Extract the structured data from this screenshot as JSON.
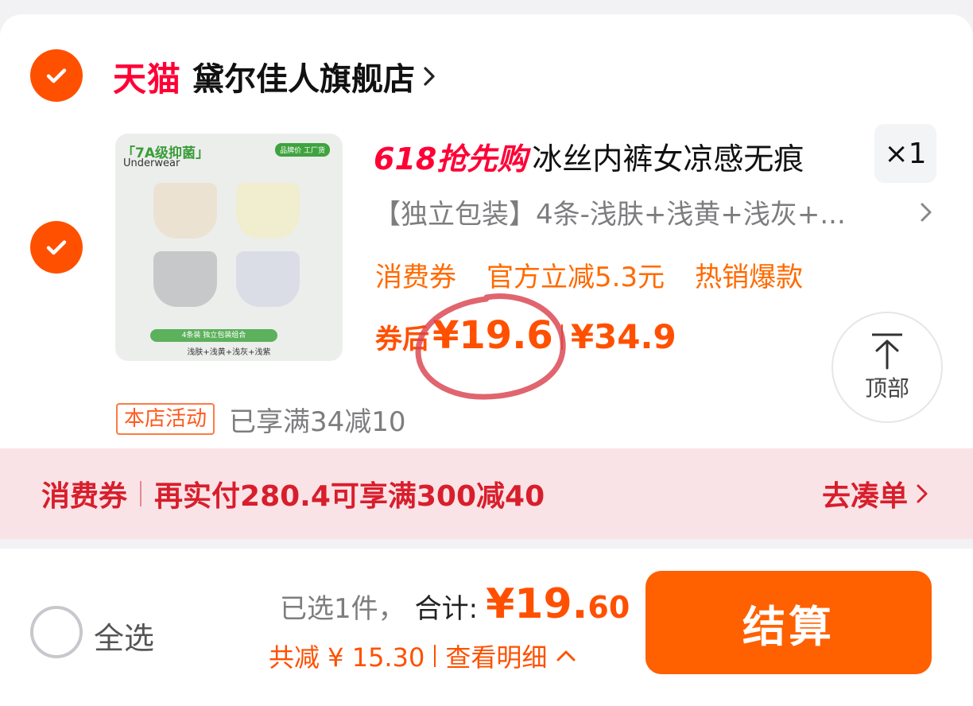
{
  "store": {
    "platform_label": "天猫",
    "name": "黛尔佳人旗舰店"
  },
  "item": {
    "thumbnail": {
      "tag": "「7A级抑菌」",
      "subtitle": "Underwear",
      "brand_badge": "品牌价 工厂货",
      "pack_bar": "4条装 独立包装组合",
      "colors_text": "浅肤+浅黄+浅灰+浅紫"
    },
    "promo": "618抢先购",
    "title": "冰丝内裤女凉感无痕",
    "quantity": "×1",
    "sku": "【独立包装】4条-浅肤+浅黄+浅灰+...",
    "tags": [
      "消费券",
      "官方立减5.3元",
      "热销爆款"
    ],
    "price_label": "券后",
    "price_now": "¥19.6",
    "price_original": "¥34.9"
  },
  "to_top": {
    "label": "顶部"
  },
  "store_activity": {
    "badge": "本店活动",
    "text": "已享满34减10"
  },
  "voucher_bar": {
    "label": "消费券",
    "text": "再实付280.4可享满300减40",
    "action": "去凑单"
  },
  "footer": {
    "select_all": "全选",
    "selected_count": "已选1件，",
    "total_label": "合计:",
    "total_main": "¥19.",
    "total_decimal": "60",
    "savings": "共减 ¥ 15.30",
    "details": "查看明细",
    "checkout": "结算"
  },
  "colors": {
    "accent": "#ff5000",
    "tmall_red": "#ff0036",
    "voucher_bg": "#fae3e6",
    "voucher_text": "#d81e2c",
    "annotation_circle": "#d9434e"
  }
}
